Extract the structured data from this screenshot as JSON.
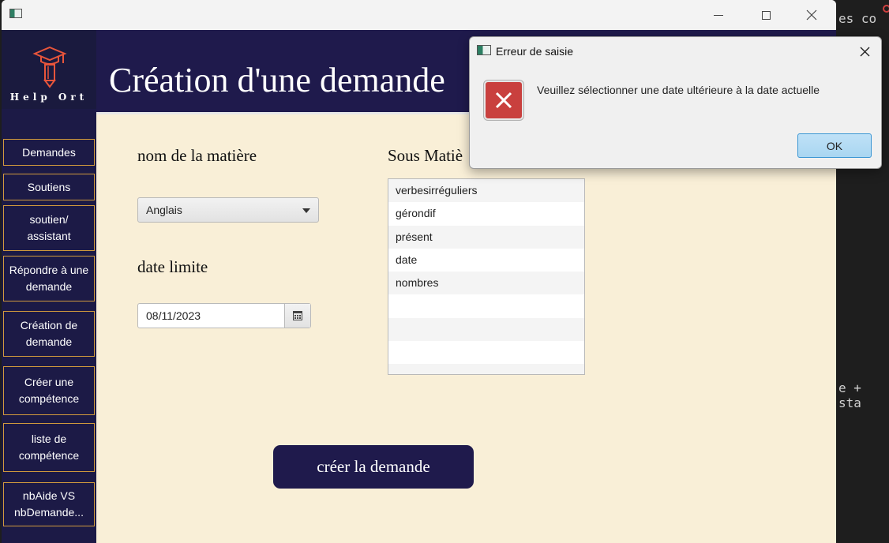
{
  "background": {
    "code_line_1": "es co",
    "code_line_2": "e + sta"
  },
  "window": {
    "title_icon": "app-icon",
    "controls": [
      "minimize-icon",
      "maximize-icon",
      "close-icon"
    ]
  },
  "sidebar": {
    "logo_text": "Help Ort",
    "items": [
      {
        "label": "Demandes"
      },
      {
        "label": "Soutiens"
      },
      {
        "label": "soutien/ assistant"
      },
      {
        "label": "Répondre à une demande"
      },
      {
        "label": "Création de demande"
      },
      {
        "label": "Créer une compétence"
      },
      {
        "label": "liste de compétence"
      },
      {
        "label": "nbAide VS nbDemande..."
      }
    ]
  },
  "header": {
    "title": "Création d'une demande"
  },
  "form": {
    "subject_label": "nom de la matière",
    "subject_value": "Anglais",
    "deadline_label": "date limite",
    "deadline_value": "08/11/2023",
    "subtopics_label": "Sous Matiè",
    "subtopics": [
      "verbesirréguliers",
      "gérondif",
      "présent",
      "date",
      "nombres",
      "",
      "",
      "",
      ""
    ],
    "submit_label": "créer la demande"
  },
  "dialog": {
    "title": "Erreur de saisie",
    "message": "Veuillez sélectionner une date ultérieure à la date actuelle",
    "ok_label": "OK"
  },
  "colors": {
    "sidebar_bg": "#1c1a46",
    "header_bg": "#1f1a4c",
    "content_bg": "#f9efd7",
    "nav_border": "#d19a3c",
    "error_red": "#c9403e"
  }
}
